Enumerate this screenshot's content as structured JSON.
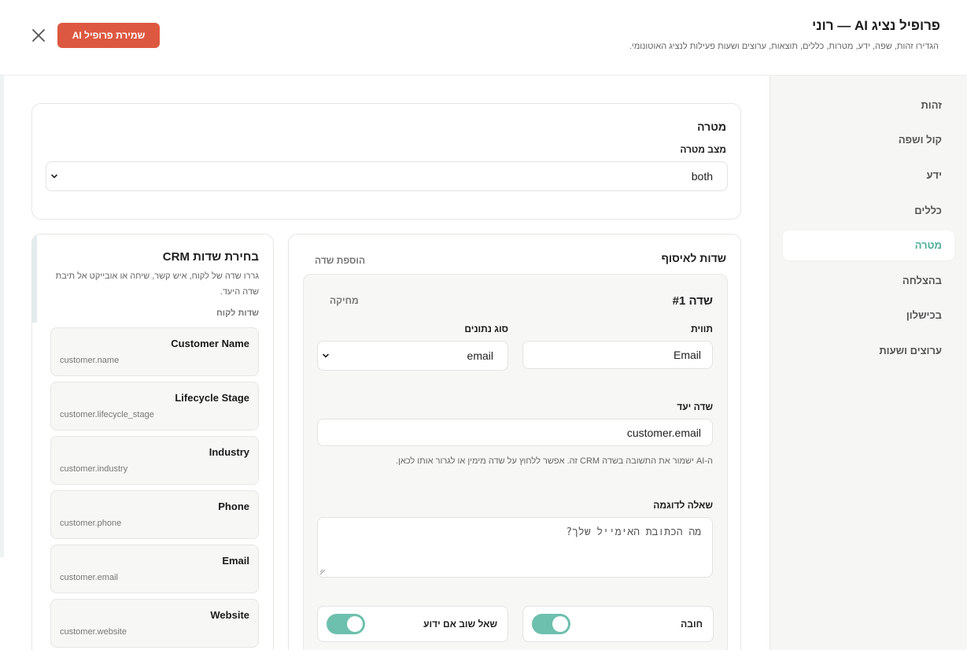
{
  "header": {
    "title": "פרופיל נציג AI — רוני",
    "subtitle": "הגדירו זהות, שפה, ידע, מטרות, כללים, תוצאות, ערוצים ושעות פעילות לנציג האוטונומי.",
    "save_label": "שמירת פרופיל AI"
  },
  "sidebar": {
    "items": [
      {
        "label": "זהות"
      },
      {
        "label": "קול ושפה"
      },
      {
        "label": "ידע"
      },
      {
        "label": "כללים"
      },
      {
        "label": "מטרה",
        "active": true
      },
      {
        "label": "בהצלחה"
      },
      {
        "label": "בכישלון"
      },
      {
        "label": "ערוצים ושעות"
      }
    ]
  },
  "goal": {
    "title": "מטרה",
    "mode_label": "מצב מטרה",
    "mode_value": "both"
  },
  "fields": {
    "title": "שדות לאיסוף",
    "add_label": "הוספת שדה",
    "field": {
      "number_label": "שדה #1",
      "delete_label": "מחיקה",
      "label_label": "תווית",
      "label_value": "Email",
      "type_label": "סוג נתונים",
      "type_value": "email",
      "target_label": "שדה יעד",
      "target_value": "customer.email",
      "helper": "ה-AI ישמור את התשובה בשדה CRM זה. אפשר ללחוץ על שדה מימין או לגרור אותו לכאן.",
      "example_label": "שאלה לדוגמה",
      "example_value": "מה הכתובת האימייל שלך?",
      "required_label": "חובה",
      "required_on": true,
      "askagain_label": "שאל שוב אם ידוע",
      "askagain_on": true
    }
  },
  "crm": {
    "title": "בחירת שדות CRM",
    "description": "גררו שדה של לקוח, איש קשר, שיחה או אובייקט אל תיבת שדה היעד.",
    "section_label": "שדות לקוח",
    "items": [
      {
        "name": "Customer Name",
        "key": "customer.name"
      },
      {
        "name": "Lifecycle Stage",
        "key": "customer.lifecycle_stage"
      },
      {
        "name": "Industry",
        "key": "customer.industry"
      },
      {
        "name": "Phone",
        "key": "customer.phone"
      },
      {
        "name": "Email",
        "key": "customer.email"
      },
      {
        "name": "Website",
        "key": "customer.website"
      }
    ]
  },
  "colors": {
    "accent": "#4cae98",
    "toggle": "#6cc0ad",
    "save_button": "#dd5840"
  }
}
